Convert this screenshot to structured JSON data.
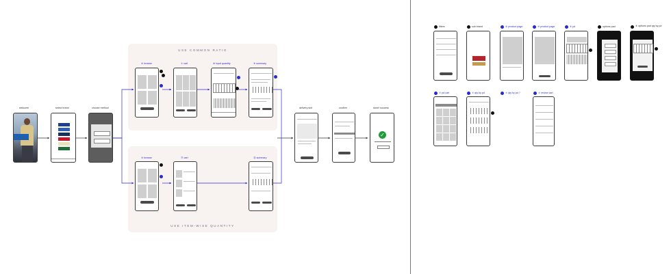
{
  "colors": {
    "flow": "#2a2ad0",
    "arrow": "#333333",
    "panel": "#f8f3f1",
    "success": "#1f9d3a"
  },
  "panels": {
    "common_ratio": "USE COMMON RATIO",
    "item_wise": "USE ITEM-WISE QUANTITY"
  },
  "main_flow": {
    "welcome": "welcome",
    "select_brand": "select brand",
    "choose_method": "choose method",
    "delivery_slot": "delivery slot",
    "confirm": "confirm",
    "done_success": "done! success"
  },
  "ratio_flow": {
    "browse": "⑥ browse",
    "cart": "⑦ cart",
    "input_quantity": "⑧ input quantity",
    "summary": "⑨ summary"
  },
  "item_flow": {
    "browse": "⑩ browse",
    "cart": "⑪ cart",
    "summary": "⑫ summary"
  },
  "appendix": {
    "filters": "filters",
    "sub_brand": "sub brand",
    "product_page_a": "⑥ product page",
    "product_page_b": "⑩ product page",
    "pd_a": "⑥ pd",
    "options_pad": "options pad",
    "options_pad_by_pd": "⑥ options pad qty by pd",
    "pd_cart": "⑦ pd cart",
    "qty_by_pd_a": "⑦ qty by pd",
    "qty_by_pd_b": "⑦ qty by pd ?",
    "review_cart": "⑦ review cart"
  }
}
